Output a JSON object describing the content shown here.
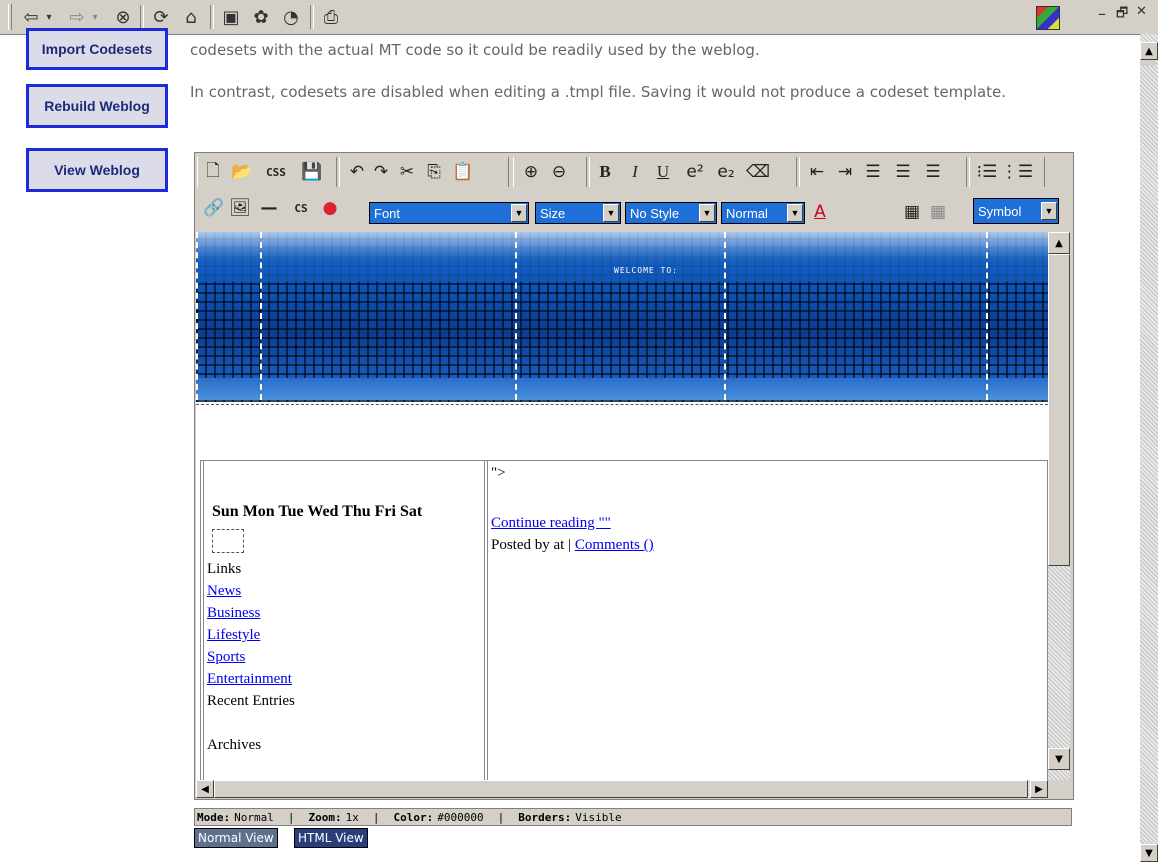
{
  "browser_toolbar": {
    "icons": [
      "back-icon",
      "back-dropdown-icon",
      "forward-icon",
      "forward-dropdown-icon",
      "stop-icon",
      "refresh-icon",
      "home-icon",
      "search-icon",
      "favorites-icon",
      "history-icon",
      "print-icon"
    ]
  },
  "window_controls": {
    "minimize": "–",
    "restore": "🗗",
    "close": "✕"
  },
  "sidebar": {
    "buttons": [
      {
        "label": "Import Codesets"
      },
      {
        "label": "Rebuild Weblog"
      },
      {
        "label": "View Weblog"
      }
    ]
  },
  "description": {
    "line1": "codesets with the actual MT code so it could be readily used by the weblog.",
    "line2": "In contrast, codesets are disabled when editing a .tmpl file. Saving it would not produce a codeset template."
  },
  "editor_toolbar": {
    "row1": [
      "new-icon",
      "open-icon",
      "CSS",
      "save-icon",
      "undo-icon",
      "redo-icon",
      "cut-icon",
      "copy-icon",
      "paste-icon",
      "zoom-in-icon",
      "zoom-out-icon",
      "B",
      "I",
      "U",
      "superscript-icon",
      "subscript-icon",
      "eraser-icon",
      "outdent-icon",
      "indent-icon",
      "align-left-icon",
      "align-center-icon",
      "align-right-icon",
      "ordered-list-icon",
      "unordered-list-icon"
    ],
    "row2_css_label": "CS",
    "font_select": "Font",
    "size_select": "Size",
    "style_select": "No Style",
    "format_select": "Normal",
    "symbol_select": "Symbol"
  },
  "banner": {
    "welcome_text": "WELCOME TO:"
  },
  "calendar": {
    "days": "Sun Mon Tue Wed Thu Fri Sat"
  },
  "left_cell": {
    "links_heading": "Links",
    "links": [
      "News",
      "Business",
      "Lifestyle",
      "Sports",
      "Entertainment"
    ],
    "recent_entries": "Recent Entries",
    "archives": "Archives"
  },
  "right_cell": {
    "fragment": "\">",
    "continue_reading": "Continue reading \"\"",
    "posted_by": "Posted by at | ",
    "comments": "Comments ()"
  },
  "status_bar": {
    "mode_label": "Mode:",
    "mode_value": "Normal",
    "zoom_label": "Zoom:",
    "zoom_value": "1x",
    "color_label": "Color:",
    "color_value": "#000000",
    "borders_label": "Borders:",
    "borders_value": "Visible"
  },
  "view_tabs": {
    "normal": "Normal View",
    "html": "HTML View"
  },
  "colors": {
    "accent_blue": "#1c2bd8",
    "link": "#0000ee",
    "select_bg": "#1f6fd9"
  }
}
